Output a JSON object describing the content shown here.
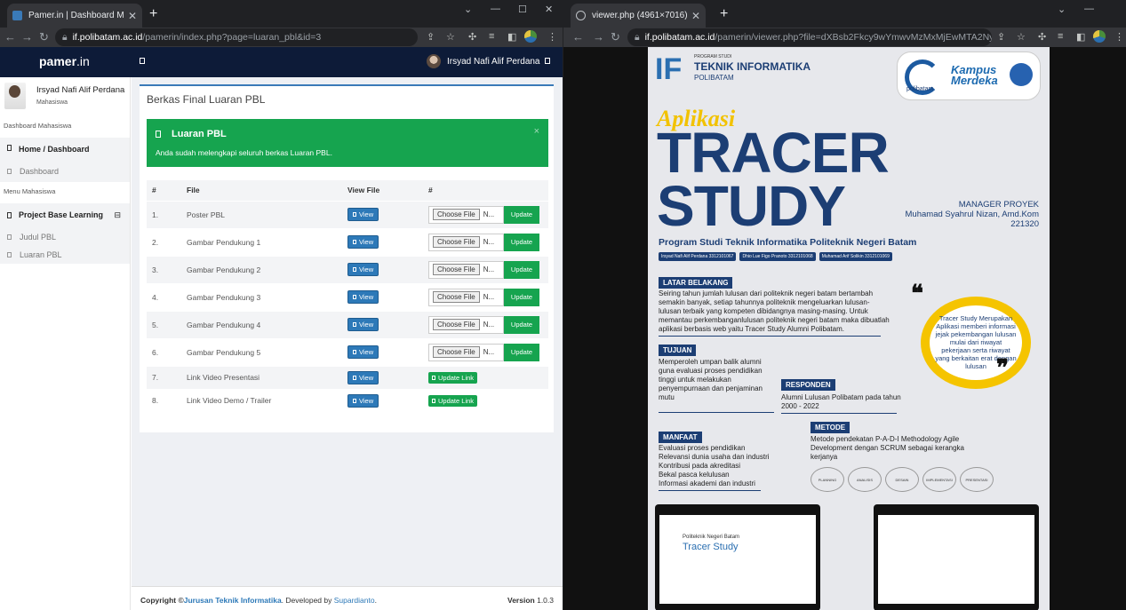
{
  "left_window": {
    "tab_title": "Pamer.in | Dashboard Mahasiswa",
    "url_host": "if.polibatam.ac.id",
    "url_path": "/pamerin/index.php?page=luaran_pbl&id=3",
    "app": {
      "brand_bold": "pamer",
      "brand_rest": ".in",
      "user_name": "Irsyad Nafi Alif Perdana"
    },
    "sidebar": {
      "user_name": "Irsyad Nafi Alif Perdana",
      "user_role": "Mahasiswa",
      "heading_dashboard": "Dashboard Mahasiswa",
      "group_home": "Home / Dashboard",
      "item_dashboard": "Dashboard",
      "heading_menu": "Menu Mahasiswa",
      "group_pbl": "Project Base Learning",
      "item_judul": "Judul PBL",
      "item_luaran": "Luaran PBL"
    },
    "card": {
      "title": "Berkas Final Luaran PBL",
      "alert_title": "Luaran PBL",
      "alert_message": "Anda sudah melengkapi seluruh berkas Luaran PBL.",
      "alert_close": "×",
      "columns": [
        "#",
        "File",
        "View File",
        "#"
      ],
      "rows": [
        {
          "no": "1.",
          "file": "Poster PBL",
          "view": "View",
          "action": "upload"
        },
        {
          "no": "2.",
          "file": "Gambar Pendukung 1",
          "view": "View",
          "action": "upload"
        },
        {
          "no": "3.",
          "file": "Gambar Pendukung 2",
          "view": "View",
          "action": "upload"
        },
        {
          "no": "4.",
          "file": "Gambar Pendukung 3",
          "view": "View",
          "action": "upload"
        },
        {
          "no": "5.",
          "file": "Gambar Pendukung 4",
          "view": "View",
          "action": "upload"
        },
        {
          "no": "6.",
          "file": "Gambar Pendukung 5",
          "view": "View",
          "action": "upload"
        },
        {
          "no": "7.",
          "file": "Link Video Presentasi",
          "view": "View",
          "action": "link"
        },
        {
          "no": "8.",
          "file": "Link Video Demo / Trailer",
          "view": "View",
          "action": "link"
        }
      ],
      "choose_file_label": "Choose File",
      "no_file_text": "N...",
      "update_label": "Update",
      "update_link_label": "Update Link"
    },
    "footer": {
      "copyright": "Copyright ©",
      "dept_link": "Jurusan Teknik Informatika",
      "developed_by": ". Developed by ",
      "dev_link": "Supardianto",
      "dot": ".",
      "version_label": "Version",
      "version": "1.0.3"
    }
  },
  "right_window": {
    "tab_title": "viewer.php (4961×7016)",
    "url_host": "if.polibatam.ac.id",
    "url_path": "/pamerin/viewer.php?file=dXBsb2Fkcy9wYmwvMzMxMjEwMTA2Ny8zMzE...",
    "poster": {
      "logo_if": "IF",
      "program_studi": "PROGRAM STUDI",
      "teknik_informatika": "TEKNIK INFORMATIKA",
      "polibatam": "POLIBATAM",
      "kampus_merdeka": "Kampus Merdeka",
      "kampus_sub": "polibatam",
      "aplikasi": "Aplikasi",
      "tracer": "TRACER",
      "study": "STUDY",
      "prodi": "Program Studi Teknik Informatika Politeknik Negeri Batam",
      "manager_title": "MANAGER PROYEK",
      "manager_name": "Muhamad Syahrul Nizan, Amd.Kom",
      "manager_id": "221320",
      "members": [
        "Irsyad Nafi Alif Perdana 3312101067",
        "Dhio Lue Figo Pranoto 3312101068",
        "Muhamad Arif Solikin 3312101069"
      ],
      "latar_title": "LATAR BELAKANG",
      "latar_text": "Seiring tahun jumlah lulusan dari politeknik negeri batam bertambah semakin banyak, setiap tahunnya politeknik mengeluarkan lulusan-lulusan terbaik yang kompeten dibidangnya masing-masing. Untuk memantau perkembanganlulusan politeknik negeri batam maka dibuatlah aplikasi berbasis web yaitu Tracer Study Alumni Polibatam.",
      "quote_text": "Tracer Study Merupakan Aplikasi memberi informasi jejak pekembangan lulusan mulai dari riwayat pekerjaan serta riwayat yang berkaitan erat dengan lulusan",
      "quote_mark_open": "❝",
      "quote_mark_close": "❞",
      "tujuan_title": "TUJUAN",
      "tujuan_text": "Memperoleh umpan balik alumni guna evaluasi proses pendidikan tinggi untuk melakukan penyempurnaan dan penjaminan mutu",
      "responden_title": "RESPONDEN",
      "responden_text": "Alumni Lulusan Polibatam pada tahun 2000 - 2022",
      "manfaat_title": "MANFAAT",
      "manfaat_items": [
        "Evaluasi proses pendidikan",
        "Relevansi dunia usaha dan industri",
        "Kontribusi pada akreditasi",
        "Bekal pasca kelulusan",
        "Informasi akademi dan industri"
      ],
      "metode_title": "METODE",
      "metode_text": "Metode pendekatan P-A-D-I Methodology Agile Development dengan SCRUM sebagai kerangka kerjanya",
      "steps": [
        "PLANNING",
        "ANALISIS",
        "DESAIN",
        "IMPLEMENTASI",
        "PRESENTASI"
      ],
      "screen_org": "Politeknik Negeri Batam",
      "screen_title": "Tracer Study"
    }
  },
  "colors": {
    "topbar": "#0d1b38",
    "success": "#16a44f",
    "primary": "#2d79b8",
    "poster_navy": "#1c3e74",
    "poster_yellow": "#f5c400"
  }
}
